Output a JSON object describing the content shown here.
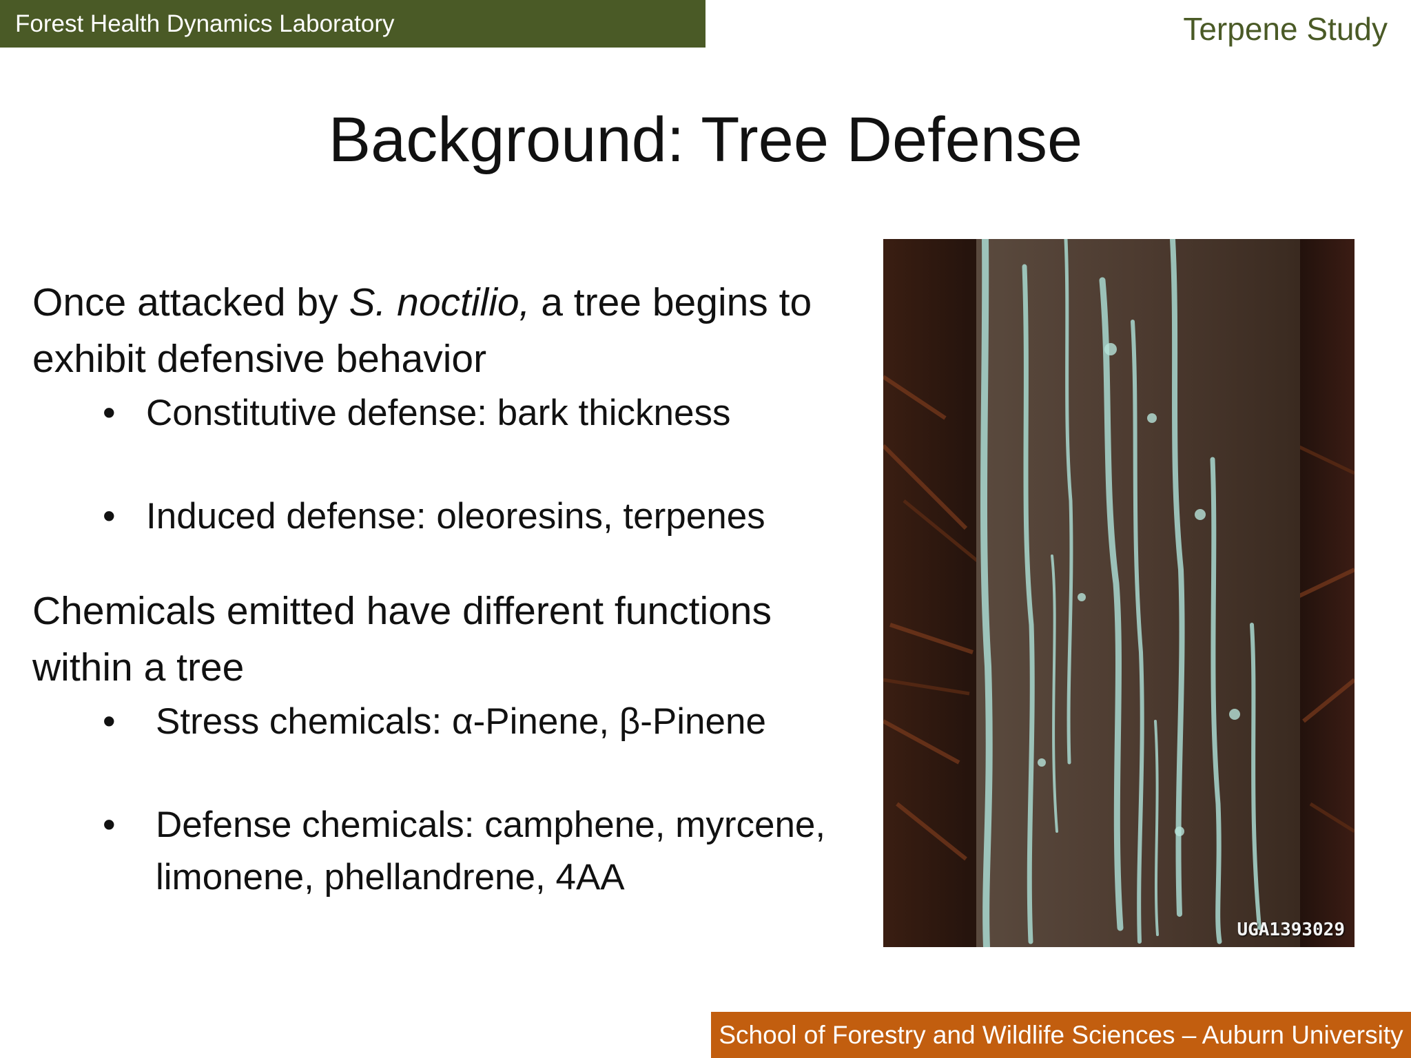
{
  "header": {
    "lab_name": "Forest Health Dynamics Laboratory",
    "study_name": "Terpene Study"
  },
  "slide": {
    "title": "Background: Tree Defense",
    "para1": {
      "prefix": "Once attacked by ",
      "species": "S. noctilio,",
      "suffix": " a tree begins to",
      "line2": "exhibit defensive behavior"
    },
    "bullets1": [
      "Constitutive defense: bark thickness",
      "Induced defense: oleoresins, terpenes"
    ],
    "para2": {
      "line1": "Chemicals emitted have different functions",
      "line2": "within a tree"
    },
    "bullets2": [
      "Stress chemicals: α-Pinene, β-Pinene",
      "Defense chemicals: camphene, myrcene,",
      "limonene, phellandrene, 4AA"
    ],
    "bullet_glyph": "•"
  },
  "photo": {
    "code": "UGA1393029",
    "colors": {
      "bark": "#4d3b30",
      "background": "#2e1a12",
      "resin": "#a9d9d0"
    }
  },
  "footer": {
    "institution": "School of Forestry and Wildlife Sciences – Auburn University"
  },
  "colors": {
    "olive": "#4a5a26",
    "orange": "#c25e0f"
  }
}
